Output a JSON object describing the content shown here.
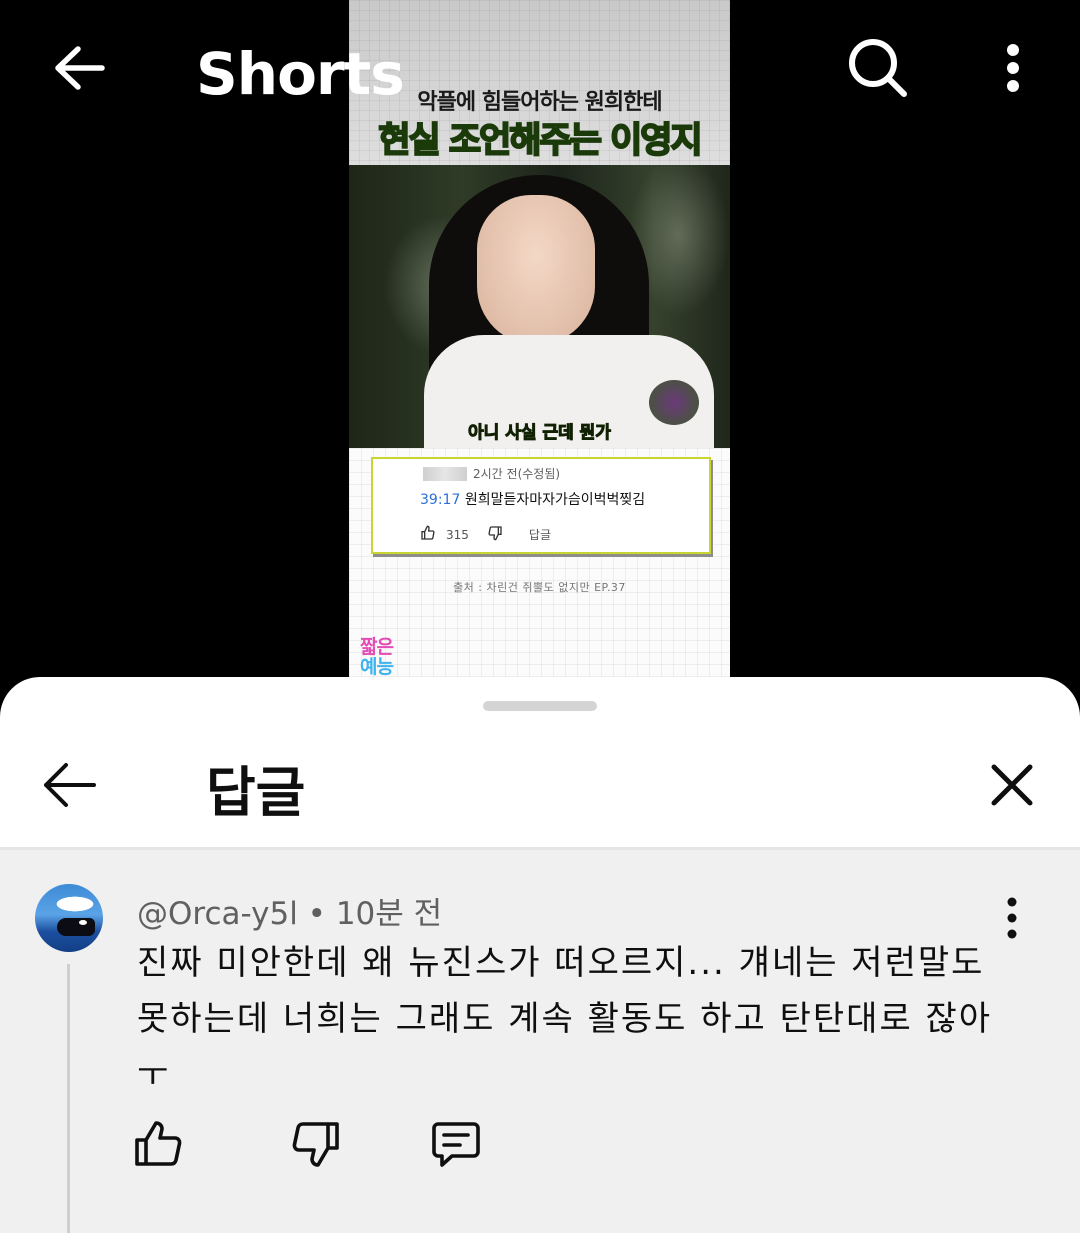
{
  "topbar": {
    "title": "Shorts",
    "back_icon": "back-arrow-icon",
    "search_icon": "search-icon",
    "more_icon": "more-vert-icon"
  },
  "video": {
    "headline_line1": "악플에 힘들어하는 원희한테",
    "headline_line2": "현실 조언해주는 이영지",
    "subtitle": "아니 사실 근데 뭔가",
    "quoted_comment": {
      "meta": "2시간 전(수정됨)",
      "timestamp": "39:17",
      "text": "원희말듣자마자가슴이벅벅찢김",
      "likes": "315",
      "reply_label": "답글"
    },
    "source": "출처 : 차린건 쥐뿔도 없지만 EP.37",
    "logo_line1": "짧은",
    "logo_line2": "예능"
  },
  "sheet": {
    "title": "답글",
    "back_icon": "back-arrow-icon",
    "close_icon": "close-icon"
  },
  "comment": {
    "meta": "@Orca-y5l • 10분 전",
    "body": "진짜 미안한데 왜 뉴진스가 떠오르지... 걔네는 저런말도 못하는데 너희는 그래도 계속 활동도 하고 탄탄대로 잖아ㅜ",
    "like_icon": "thumb-up-icon",
    "dislike_icon": "thumb-down-icon",
    "reply_icon": "comment-icon"
  },
  "colors": {
    "headline_green": "#6fd62a",
    "subtitle_green": "#b9ff2f",
    "timestamp_blue": "#2b6fd6",
    "sheet_bg": "#ffffff",
    "comment_bg": "#f0f0f0"
  }
}
